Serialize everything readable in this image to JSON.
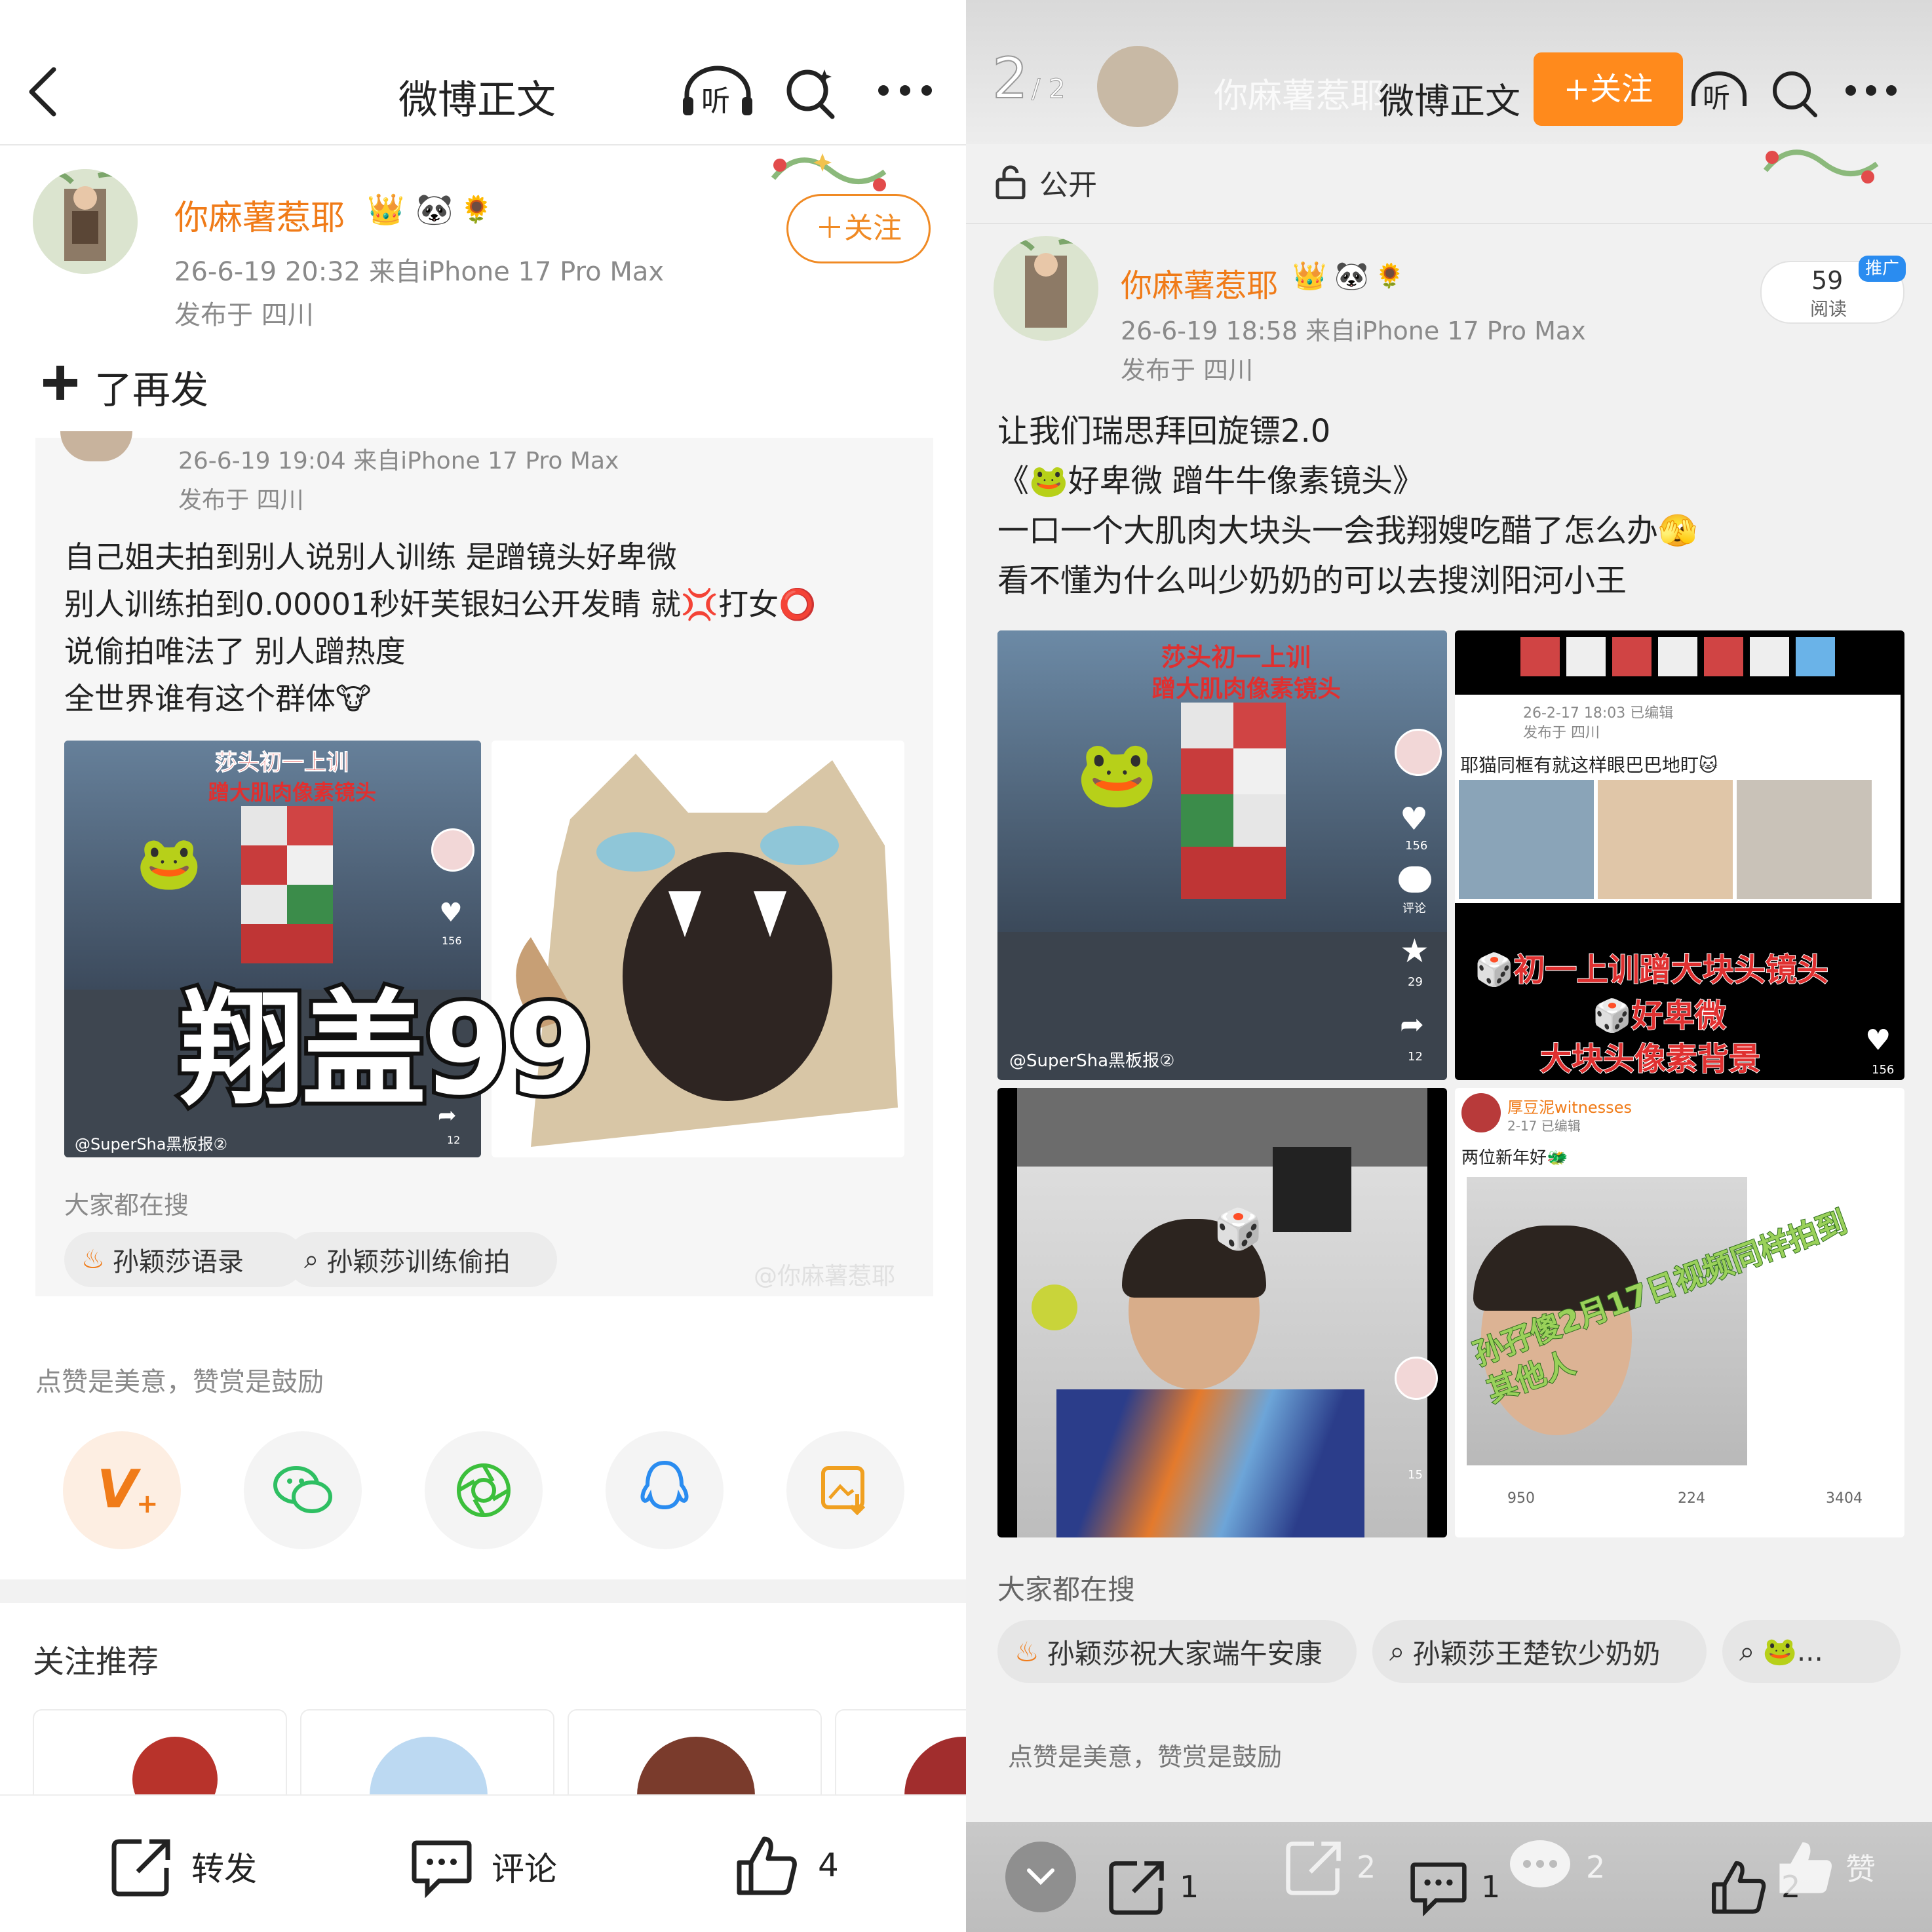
{
  "left": {
    "header": {
      "title": "微博正文",
      "listen_label": "听"
    },
    "author": {
      "name": "你麻薯惹耶",
      "meta_line1": "26-6-19 20:32  来自iPhone 17 Pro Max",
      "meta_line2": "发布于 四川",
      "follow_label": "＋关注"
    },
    "repost_note": "了再发",
    "quoted": {
      "meta_line1": "26-6-19 19:04  来自iPhone 17 Pro Max",
      "meta_line2": "发布于 四川",
      "lines": [
        "自己姐夫拍到别人说别人训练 是蹭镜头好卑微",
        "别人训练拍到0.00001秒奸芙银妇公开发睛  就💢打女⭕",
        "说偷拍唯法了 别人蹭热度",
        "全世界谁有这个群体🐮"
      ],
      "image1": {
        "caption_top": "莎头初一上训",
        "caption_mid": "蹭大肌肉像素镜头",
        "watermark": "@SuperSha黑板报②",
        "likes": "156",
        "shares": "12"
      },
      "overlay_text": "翔盖99",
      "search_title": "大家都在搜",
      "search_tags": [
        "孙颖莎语录",
        "孙颖莎训练偷拍"
      ],
      "weibo_watermark": "@你麻薯惹耶"
    },
    "reward_text": "点赞是美意，赞赏是鼓励",
    "follow_recommend_title": "关注推荐",
    "bottom_bar": {
      "repost": "转发",
      "comment": "评论",
      "like_count": "4"
    }
  },
  "right": {
    "header": {
      "page_indicator": "2",
      "page_total": "/ 2",
      "ghost_name": "你麻薯惹耶",
      "title": "微博正文",
      "follow_label": "+关注",
      "listen_label": "听"
    },
    "visibility": "公开",
    "author": {
      "name": "你麻薯惹耶",
      "meta_line1": "26-6-19 18:58  来自iPhone 17 Pro Max",
      "meta_line2": "发布于 四川",
      "read_count": "59",
      "read_label": "阅读",
      "promo_badge": "推广"
    },
    "post_lines": [
      "让我们瑞思拜回旋镖2.0",
      "《🐸好卑微 蹭牛牛像素镜头》",
      "一口一个大肌肉大块头一会我翔嫂吃醋了怎么办🫣",
      "看不懂为什么叫少奶奶的可以去搜浏阳河小王"
    ],
    "grid": {
      "img1": {
        "caption_top": "莎头初一上训",
        "caption_mid": "蹭大肌肉像素镜头",
        "watermark": "@SuperSha黑板报②",
        "likes": "156",
        "comments": "评论",
        "stars": "29",
        "shares": "12"
      },
      "img2": {
        "meta": "26-2-17 18:03  已编辑",
        "meta2": "发布于 四川",
        "inner_text": "耶猫同框有就这样眼巴巴地盯🐱",
        "caption1": "🎲初一上训蹭大块头镜头",
        "caption2": "🎲好卑微",
        "caption3": "大块头像素背景",
        "likes": "156"
      },
      "img3": {
        "likes": "15"
      },
      "img4": {
        "user": "厚豆泥witnesses",
        "date": "2-17  已编辑",
        "text": "两位新年好🐲",
        "overlay": "孙孖傻2月17日视频同样拍到其他人",
        "reposts": "950",
        "comments": "224",
        "likes": "3404"
      }
    },
    "search_title": "大家都在搜",
    "search_tags": [
      "孙颖莎祝大家端午安康",
      "孙颖莎王楚钦少奶奶",
      "🐸..."
    ],
    "reward_text": "点赞是美意，赞赏是鼓励",
    "bottom_bar": {
      "repost_count": "1",
      "ghost_repost_count": "2",
      "comment_count": "1",
      "ghost_comment_count": "2",
      "like_count": "2",
      "ghost_like_label": "赞"
    }
  }
}
